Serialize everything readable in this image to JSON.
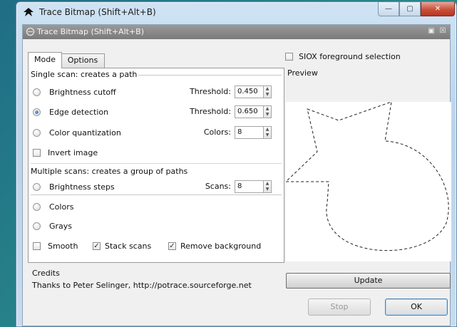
{
  "window": {
    "title": "Trace Bitmap (Shift+Alt+B)",
    "minimize_glyph": "—",
    "maximize_glyph": "▢",
    "close_glyph": "✕"
  },
  "dock": {
    "title": "Trace Bitmap (Shift+Alt+B)",
    "pin_glyph": "▣",
    "close_glyph": "☒"
  },
  "tabs": [
    {
      "label": "Mode",
      "active": true
    },
    {
      "label": "Options",
      "active": false
    }
  ],
  "single_scan": {
    "heading": "Single scan: creates a path",
    "brightness": {
      "label": "Brightness cutoff",
      "field_label": "Threshold:",
      "value": "0.450"
    },
    "edge": {
      "label": "Edge detection",
      "field_label": "Threshold:",
      "value": "0.650"
    },
    "color_quant": {
      "label": "Color quantization",
      "field_label": "Colors:",
      "value": "8"
    },
    "invert_label": "Invert image"
  },
  "multiple_scans": {
    "heading": "Multiple scans: creates a group of paths",
    "brightness_steps": {
      "label": "Brightness steps",
      "field_label": "Scans:",
      "value": "8"
    },
    "colors_label": "Colors",
    "grays_label": "Grays",
    "smooth_label": "Smooth",
    "stack_label": "Stack scans",
    "remove_bg_label": "Remove background"
  },
  "selected_mode": "edge",
  "checkboxes": {
    "invert": false,
    "smooth": false,
    "stack": true,
    "remove_bg": true,
    "siox": false
  },
  "credits": {
    "label": "Credits",
    "text": "Thanks to Peter Selinger, http://potrace.sourceforge.net"
  },
  "siox_label": "SIOX foreground selection",
  "preview_label": "Preview",
  "update_label": "Update",
  "stop_label": "Stop",
  "ok_label": "OK",
  "check_glyph": "✓",
  "spin_up_glyph": "▲",
  "spin_down_glyph": "▼"
}
